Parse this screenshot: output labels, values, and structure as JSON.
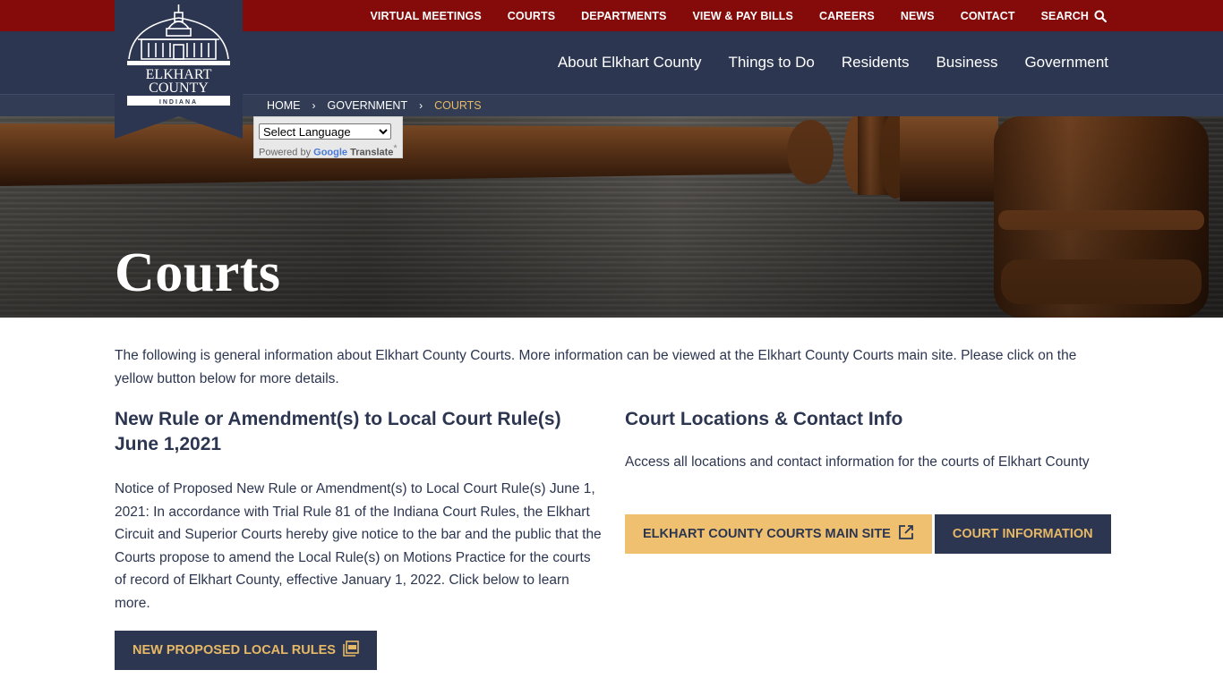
{
  "logo": {
    "line1": "ELKHART",
    "line2": "COUNTY",
    "line3": "INDIANA"
  },
  "topnav": [
    "VIRTUAL MEETINGS",
    "COURTS",
    "DEPARTMENTS",
    "VIEW & PAY BILLS",
    "CAREERS",
    "NEWS",
    "CONTACT"
  ],
  "search_label": "SEARCH",
  "mainnav": [
    "About Elkhart County",
    "Things to Do",
    "Residents",
    "Business",
    "Government"
  ],
  "breadcrumb": {
    "home": "HOME",
    "parent": "GOVERNMENT",
    "current": "COURTS"
  },
  "translate": {
    "select_label": "Select Language",
    "powered_by": "Powered by",
    "google": "Google",
    "translate": "Translate"
  },
  "hero": {
    "title": "Courts"
  },
  "intro": "The following is general information about Elkhart County Courts. More information can be viewed at the Elkhart County Courts main site. Please click on the yellow button below for more details.",
  "left": {
    "heading": "New Rule or Amendment(s) to Local Court Rule(s) June 1,2021",
    "body": "Notice of Proposed New Rule or Amendment(s) to Local Court Rule(s) June 1, 2021: In accordance with Trial Rule 81 of the Indiana Court Rules, the Elkhart Circuit and Superior Courts hereby give notice to the bar and the public that the Courts propose to amend the Local Rule(s) on Motions Practice for the courts of record of Elkhart County, effective January 1, 2022. Click below to learn more.",
    "button": "NEW PROPOSED LOCAL RULES"
  },
  "right": {
    "heading": "Court Locations & Contact Info",
    "body": "Access all locations and contact information for the courts of Elkhart County",
    "button_main": "ELKHART COUNTY COURTS MAIN SITE",
    "button_info": "COURT INFORMATION"
  },
  "colors": {
    "navy": "#2c3650",
    "maroon": "#850b0b",
    "gold": "#efc070",
    "gold_text": "#e7b866"
  }
}
